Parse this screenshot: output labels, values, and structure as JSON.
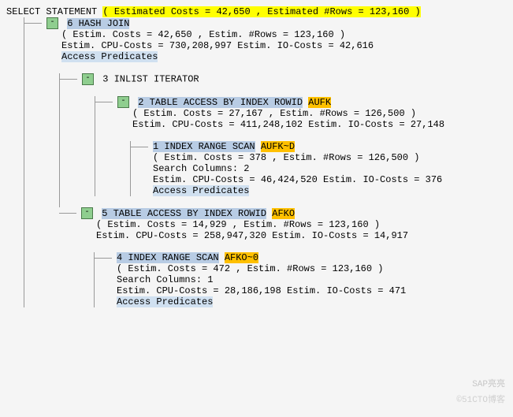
{
  "root": {
    "label": "SELECT STATEMENT",
    "estimate": "( Estimated Costs = 42,650 , Estimated #Rows = 123,160 )"
  },
  "n6": {
    "label": "6 HASH JOIN",
    "estim": "( Estim. Costs = 42,650 , Estim. #Rows = 123,160 )",
    "cpu": "Estim. CPU-Costs = 730,208,997 Estim. IO-Costs = 42,616",
    "pred": "Access Predicates"
  },
  "n3": {
    "label": "3 INLIST ITERATOR"
  },
  "n2": {
    "label": "2 TABLE ACCESS BY INDEX ROWID",
    "table": "AUFK",
    "estim": "( Estim. Costs = 27,167 , Estim. #Rows = 126,500 )",
    "cpu": "Estim. CPU-Costs = 411,248,102 Estim. IO-Costs = 27,148"
  },
  "n1": {
    "label": "1 INDEX RANGE SCAN",
    "index": "AUFK~D",
    "estim": "( Estim. Costs = 378 , Estim. #Rows = 126,500 )",
    "search": "Search Columns: 2",
    "cpu": "Estim. CPU-Costs = 46,424,520 Estim. IO-Costs = 376",
    "pred": "Access Predicates"
  },
  "n5": {
    "label": "5 TABLE ACCESS BY INDEX ROWID",
    "table": "AFKO",
    "estim": "( Estim. Costs = 14,929 , Estim. #Rows = 123,160 )",
    "cpu": "Estim. CPU-Costs = 258,947,320 Estim. IO-Costs = 14,917"
  },
  "n4": {
    "label": "4 INDEX RANGE SCAN",
    "index": "AFKO~0",
    "estim": "( Estim. Costs = 472 , Estim. #Rows = 123,160 )",
    "search": "Search Columns: 1",
    "cpu": "Estim. CPU-Costs = 28,186,198 Estim. IO-Costs = 471",
    "pred": "Access Predicates"
  },
  "watermark1": "SAP亮亮",
  "watermark2": "©51CTO博客"
}
